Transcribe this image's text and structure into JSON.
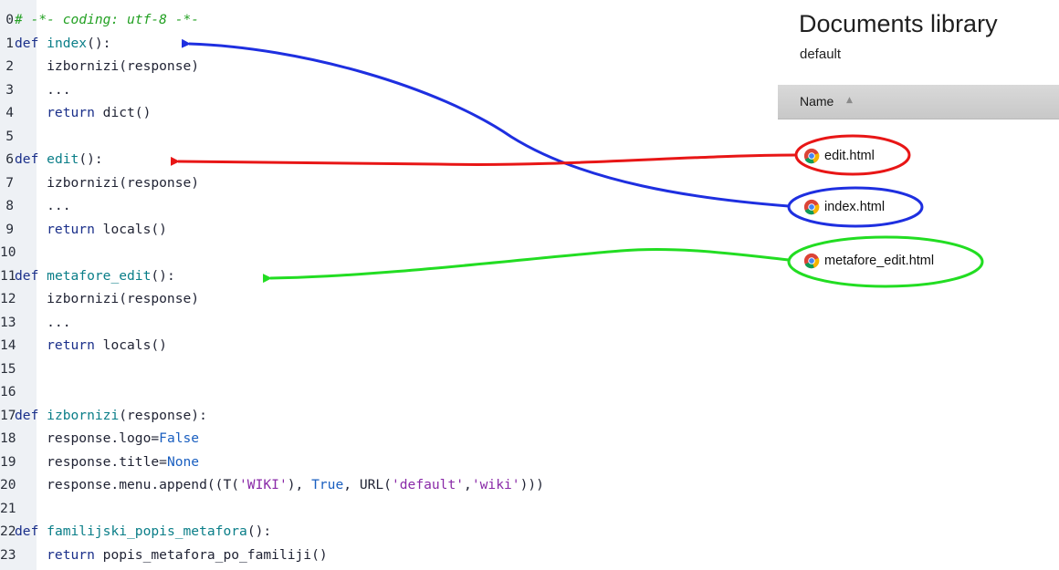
{
  "editor": {
    "lines": [
      {
        "n": "0",
        "tokens": [
          {
            "t": "# -*- coding: utf-8 -*-",
            "c": "cm"
          }
        ]
      },
      {
        "n": "1",
        "tokens": [
          {
            "t": "def ",
            "c": "kw"
          },
          {
            "t": "index",
            "c": "fn"
          },
          {
            "t": "():",
            "c": ""
          }
        ]
      },
      {
        "n": "2",
        "tokens": [
          {
            "t": "    izbornizi(response)",
            "c": ""
          }
        ]
      },
      {
        "n": "3",
        "tokens": [
          {
            "t": "    ...",
            "c": ""
          }
        ]
      },
      {
        "n": "4",
        "tokens": [
          {
            "t": "    return ",
            "c": "kw"
          },
          {
            "t": "dict()",
            "c": ""
          }
        ]
      },
      {
        "n": "5",
        "tokens": []
      },
      {
        "n": "6",
        "tokens": [
          {
            "t": "def ",
            "c": "kw"
          },
          {
            "t": "edit",
            "c": "fn"
          },
          {
            "t": "():",
            "c": ""
          }
        ]
      },
      {
        "n": "7",
        "tokens": [
          {
            "t": "    izbornizi(response)",
            "c": ""
          }
        ]
      },
      {
        "n": "8",
        "tokens": [
          {
            "t": "    ...",
            "c": ""
          }
        ]
      },
      {
        "n": "9",
        "tokens": [
          {
            "t": "    return ",
            "c": "kw"
          },
          {
            "t": "locals()",
            "c": ""
          }
        ]
      },
      {
        "n": "10",
        "tokens": []
      },
      {
        "n": "11",
        "tokens": [
          {
            "t": "def ",
            "c": "kw"
          },
          {
            "t": "metafore_edit",
            "c": "fn"
          },
          {
            "t": "():",
            "c": ""
          }
        ]
      },
      {
        "n": "12",
        "tokens": [
          {
            "t": "    izbornizi(response)",
            "c": ""
          }
        ]
      },
      {
        "n": "13",
        "tokens": [
          {
            "t": "    ...",
            "c": ""
          }
        ]
      },
      {
        "n": "14",
        "tokens": [
          {
            "t": "    return ",
            "c": "kw"
          },
          {
            "t": "locals()",
            "c": ""
          }
        ]
      },
      {
        "n": "15",
        "tokens": []
      },
      {
        "n": "16",
        "tokens": []
      },
      {
        "n": "17",
        "tokens": [
          {
            "t": "def ",
            "c": "kw"
          },
          {
            "t": "izbornizi",
            "c": "fn"
          },
          {
            "t": "(response):",
            "c": ""
          }
        ]
      },
      {
        "n": "18",
        "tokens": [
          {
            "t": "    response.logo=",
            "c": ""
          },
          {
            "t": "False",
            "c": "nm"
          }
        ]
      },
      {
        "n": "19",
        "tokens": [
          {
            "t": "    response.title=",
            "c": ""
          },
          {
            "t": "None",
            "c": "nm"
          }
        ]
      },
      {
        "n": "20",
        "tokens": [
          {
            "t": "    response.menu.append((T(",
            "c": ""
          },
          {
            "t": "'WIKI'",
            "c": "st"
          },
          {
            "t": "), ",
            "c": ""
          },
          {
            "t": "True",
            "c": "nm"
          },
          {
            "t": ", URL(",
            "c": ""
          },
          {
            "t": "'default'",
            "c": "st"
          },
          {
            "t": ",",
            "c": ""
          },
          {
            "t": "'wiki'",
            "c": "st"
          },
          {
            "t": ")))",
            "c": ""
          }
        ]
      },
      {
        "n": "21",
        "tokens": []
      },
      {
        "n": "22",
        "tokens": [
          {
            "t": "def ",
            "c": "kw"
          },
          {
            "t": "familijski_popis_metafora",
            "c": "fn"
          },
          {
            "t": "():",
            "c": ""
          }
        ]
      },
      {
        "n": "23",
        "tokens": [
          {
            "t": "    return ",
            "c": "kw"
          },
          {
            "t": "popis_metafora_po_familiji()",
            "c": ""
          }
        ]
      }
    ]
  },
  "library": {
    "title": "Documents library",
    "subtitle": "default",
    "column_header": "Name",
    "files": [
      {
        "name": "edit.html",
        "icon": "chrome-icon"
      },
      {
        "name": "index.html",
        "icon": "chrome-icon"
      },
      {
        "name": "metafore_edit.html",
        "icon": "chrome-icon"
      }
    ]
  },
  "annotations": {
    "colors": {
      "index": "#1e2fe0",
      "edit": "#e81616",
      "metafore_edit": "#22dd22"
    },
    "links": [
      {
        "from": "index.html",
        "to_line": "1",
        "color": "#1e2fe0"
      },
      {
        "from": "edit.html",
        "to_line": "6",
        "color": "#e81616"
      },
      {
        "from": "metafore_edit.html",
        "to_line": "11",
        "color": "#22dd22"
      }
    ]
  }
}
